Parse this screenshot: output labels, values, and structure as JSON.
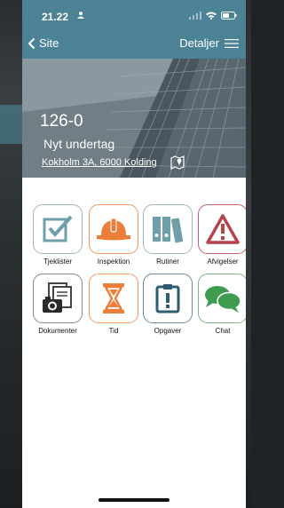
{
  "status": {
    "time": "21.22"
  },
  "nav": {
    "back_label": "Site",
    "details_label": "Detaljer"
  },
  "hero": {
    "code": "126-0",
    "title": "Nyt undertag",
    "address": "Kokholm 3A, 6000 Kolding"
  },
  "menu": [
    {
      "label": "Tjeklister",
      "icon": "checklist-icon"
    },
    {
      "label": "Inspektion",
      "icon": "hard-hat-icon"
    },
    {
      "label": "Rutiner",
      "icon": "binders-icon"
    },
    {
      "label": "Afvigelser",
      "icon": "warning-icon"
    },
    {
      "label": "Dokumenter",
      "icon": "documents-camera-icon"
    },
    {
      "label": "Tid",
      "icon": "hourglass-icon"
    },
    {
      "label": "Opgaver",
      "icon": "task-clipboard-icon"
    },
    {
      "label": "Chat",
      "icon": "chat-bubbles-icon"
    }
  ],
  "colors": {
    "header": "#4b8296",
    "teal_border": "#6f9fab",
    "orange": "#ee7d3a",
    "red": "#b8424b",
    "green": "#3e9b4f",
    "navy": "#2f5d72"
  }
}
